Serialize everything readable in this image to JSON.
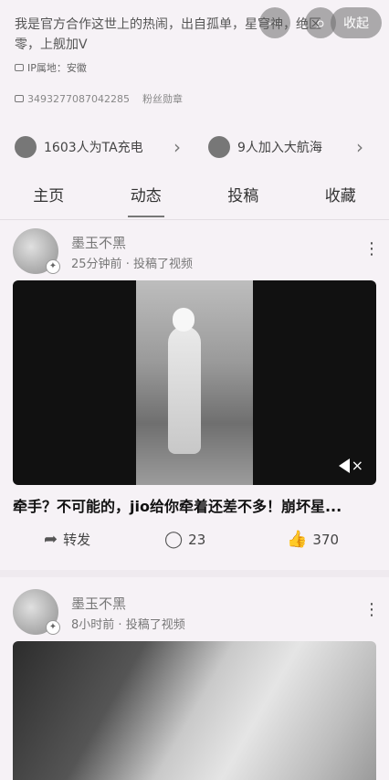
{
  "top": {
    "more_glyph": "⋯",
    "search_glyph": "⌕",
    "collapse_label": "收起"
  },
  "profile": {
    "bio": "我是官方合作这世上的热闹，出自孤单，星穹神，绝区零，上舰加V",
    "ip_label": "IP属地：安徽",
    "uid": "3493277087042285",
    "fan_badge": "粉丝勋章"
  },
  "support": {
    "charge_text": "1603人为TA充电",
    "fleet_text": "9人加入大航海",
    "chevron": "›"
  },
  "tabs": [
    {
      "label": "主页"
    },
    {
      "label": "动态"
    },
    {
      "label": "投稿"
    },
    {
      "label": "收藏"
    }
  ],
  "posts": [
    {
      "author": "墨玉不黑",
      "time": "25分钟前",
      "action": "投稿了视频",
      "title": "牵手？不可能的，jio给你牵着还差不多！崩坏星...",
      "repost_label": "转发",
      "comments": "23",
      "likes": "370"
    },
    {
      "author": "墨玉不黑",
      "time": "8小时前",
      "action": "投稿了视频"
    }
  ],
  "icons": {
    "more": "⋮",
    "mute": "×",
    "repost": "➦",
    "comment": "◯",
    "like": "👍"
  }
}
